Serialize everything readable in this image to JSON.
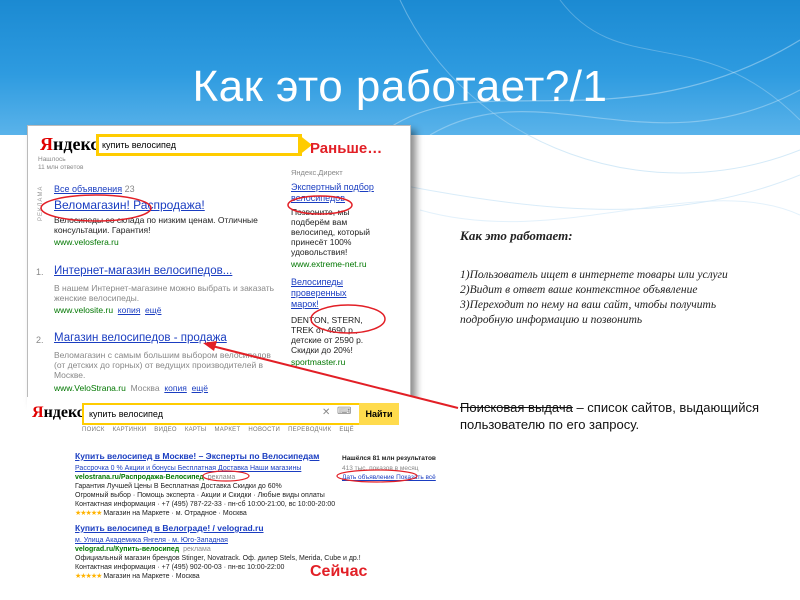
{
  "slide": {
    "title": "Как это работает?/1"
  },
  "labels": {
    "before": "Раньше…",
    "now": "Сейчас"
  },
  "explain": {
    "title": "Как это работает:",
    "steps": [
      "1)Пользователь ищет в интернете товары или услуги",
      "2)Видит в ответ ваше контекстное объявление",
      "3)Переходит по нему на ваш сайт, чтобы получить подробную информацию и позвонить"
    ],
    "definition_term": "Поисковая выдача",
    "definition_rest": " – список сайтов, выдающийся пользователю по его запросу."
  },
  "old_yandex": {
    "logo_first": "Я",
    "logo_rest": "ндекс",
    "query": "купить велосипед",
    "found_1": "Нашлось",
    "found_2": "11 млн ответов",
    "all_ads": "Все объявления",
    "all_ads_count": "23",
    "ad1_title": "Веломагазин! Распродажа!",
    "ad1_text_1": "Велосипеды со склада по низким ценам. Отличные",
    "ad1_text_2": "консультации. Гарантия!",
    "ad1_url": "www.velosfera.ru",
    "vertical_label": "РЕКЛАМА",
    "r1_num": "1.",
    "r1_title": "Интернет-магазин велосипедов...",
    "r1_text_1": "В нашем Интернет-магазине можно выбрать и заказать",
    "r1_text_2": "женские велосипеды.",
    "r1_url": "www.velosite.ru",
    "r1_copy": "копия",
    "r1_more": "ещё",
    "r2_num": "2.",
    "r2_title": "Магазин велосипедов - продажа",
    "r2_text_1": "Веломагазин с самым большим выбором велосипедов",
    "r2_text_2": "(от детских до горных) от ведущих производителей в",
    "r2_text_3": "Москве.",
    "r2_url": "www.VeloStrana.ru",
    "r2_city": "Москва",
    "r2_copy": "копия",
    "r2_more": "ещё",
    "direct_label": "Яндекс.Директ",
    "d1_title_1": "Экспертный подбор",
    "d1_title_2": "велосипедов",
    "d1_text_1": "Позвоните, мы",
    "d1_text_2": "подберём вам",
    "d1_text_3": "велосипед, который",
    "d1_text_4": "принесёт 100%",
    "d1_text_5": "удовольствия!",
    "d1_url": "www.extreme-net.ru",
    "d2_title_1": "Велосипеды",
    "d2_title_2": "проверенных",
    "d2_title_3": "марок!",
    "d2_text_1": "DENTON, STERN,",
    "d2_text_2": "TREK от 4690 р.,",
    "d2_text_3": "детские от 2590 р.",
    "d2_text_4": "Скидки до 20%!",
    "d2_url": "sportmaster.ru"
  },
  "new_yandex": {
    "logo_first": "Я",
    "logo_rest": "ндекс",
    "query": "купить велосипед",
    "button": "Найти",
    "tabs": "ПОИСК КАРТИНКИ ВИДЕО КАРТЫ МАРКЕТ НОВОСТИ ПЕРЕВОДЧИК ЕЩЁ",
    "r1_title": "Купить велосипед в Москве! – Эксперты по Велосипедам",
    "r1_line1": "Рассрочка 0 %   Акции и бонусы   Бесплатная Доставка   Наши магазины",
    "r1_url": "velostrana.ru/Распродажа-Велосипед",
    "r1_ad": "реклама",
    "r1_line2": "Гарантия Лучшей Цены В Бесплатная Доставка Скидки до 60%",
    "r1_line3": "Огромный выбор · Помощь эксперта · Акции и Скидки · Любые виды оплаты",
    "r1_line4": "Контактная информация · +7 (495) 787-22-33 · пн-сб 10:00-21:00, вс 10:00-20:00",
    "r1_market": "Магазин на Маркете · м. Отрадное · Москва",
    "side_found": "Нашёлся 81 млн результатов",
    "side_shows": "413 тыс. показов в месяц",
    "side_links": "Дать объявление   Показать всё",
    "r2_title": "Купить велосипед в Велограде! / velograd.ru",
    "r2_line1": "м. Улица Академика Янгеля · м. Юго-Западная",
    "r2_url": "velograd.ru/Купить-велосипед",
    "r2_ad": "реклама",
    "r2_line2": "Официальный магазин брендов Stinger, Novatrack. Оф. дилер Stels, Merida, Cube и др.!",
    "r2_line3": "Контактная информация · +7 (495) 902-00-03 · пн-вс 10:00-22:00",
    "r2_market": "Магазин на Маркете · Москва"
  }
}
